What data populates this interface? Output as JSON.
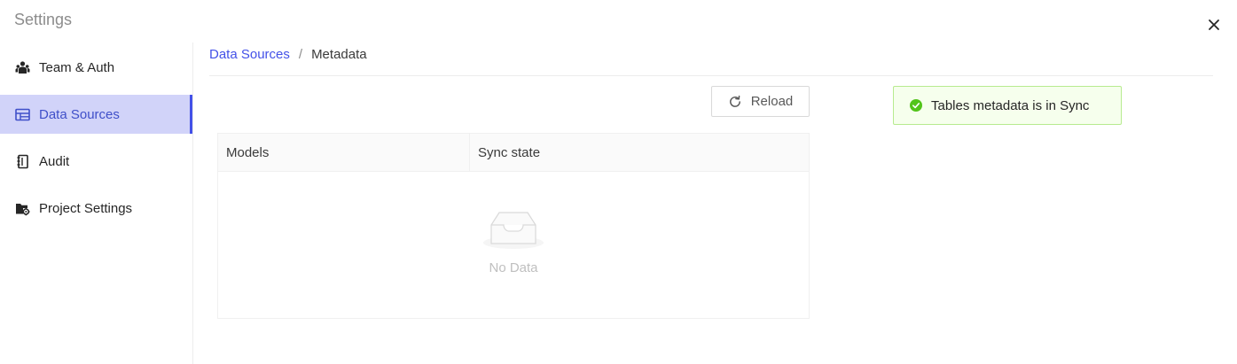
{
  "window": {
    "title": "Settings",
    "close_icon": "close-icon"
  },
  "sidebar": {
    "items": [
      {
        "label": "Team & Auth",
        "icon": "team-icon",
        "active": false
      },
      {
        "label": "Data Sources",
        "icon": "data-sources-icon",
        "active": true
      },
      {
        "label": "Audit",
        "icon": "audit-icon",
        "active": false
      },
      {
        "label": "Project Settings",
        "icon": "project-settings-icon",
        "active": false
      }
    ],
    "active_color": "#4351e8",
    "active_bg": "#d1d3f9"
  },
  "breadcrumb": {
    "parent": "Data Sources",
    "separator": "/",
    "current": "Metadata"
  },
  "toolbar": {
    "reload_label": "Reload",
    "reload_icon": "reload-icon"
  },
  "table": {
    "columns": [
      "Models",
      "Sync state"
    ],
    "rows": [],
    "empty_text": "No Data",
    "empty_icon": "empty-inbox-icon"
  },
  "alert": {
    "type": "success",
    "message": "Tables metadata is in Sync",
    "icon": "check-circle-icon",
    "color": "#52c41a"
  }
}
